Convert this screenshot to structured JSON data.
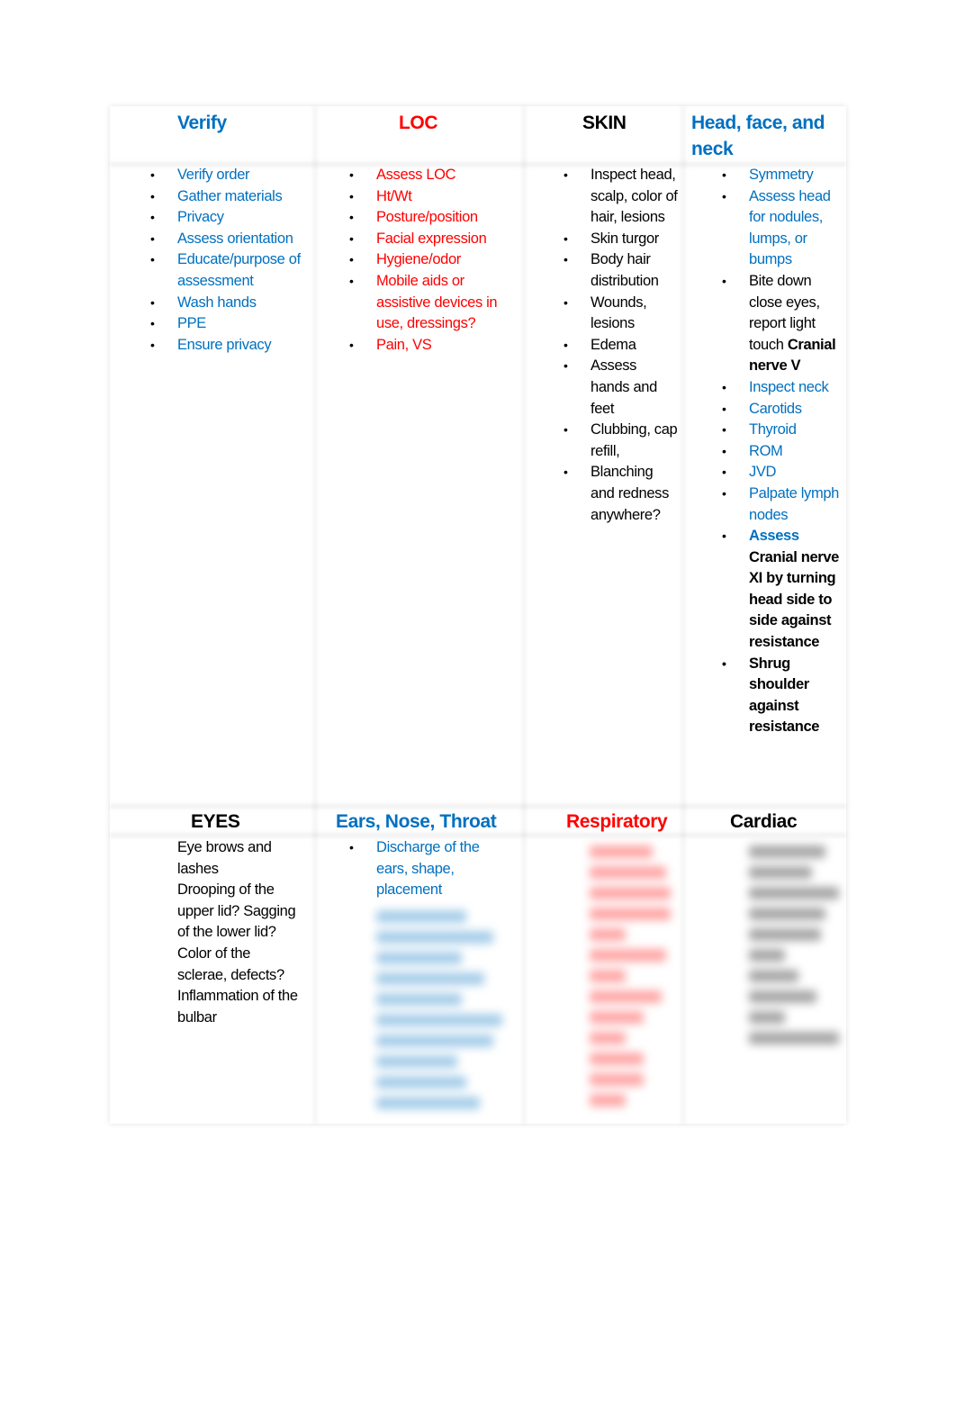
{
  "colors": {
    "blue": "#0070c0",
    "red": "#ff0000",
    "black": "#000000"
  },
  "row1": {
    "headers": [
      "Verify",
      "LOC",
      "SKIN",
      "Head, face, and neck"
    ],
    "verify": [
      "Verify order",
      "Gather materials",
      "Privacy",
      "Assess orientation",
      "Educate/purpose of assessment",
      "Wash hands",
      "PPE",
      "Ensure privacy"
    ],
    "loc": [
      "Assess LOC",
      "Ht/Wt",
      "Posture/position",
      "Facial expression",
      "Hygiene/odor",
      "Mobile aids or assistive devices in use, dressings?",
      "Pain, VS"
    ],
    "skin": [
      "Inspect head, scalp, color of hair, lesions",
      "Skin turgor",
      "Body hair distribution",
      "Wounds, lesions",
      "Edema",
      "Assess hands and feet",
      "Clubbing, cap refill,",
      "Blanching and redness anywhere?"
    ],
    "head": {
      "symmetry": "Symmetry",
      "nodules": "Assess head for nodules, lumps, or bumps",
      "bite": "Bite down close eyes, report  light touch",
      "cn5": "Cranial nerve V",
      "neck": "Inspect neck",
      "carotids": "Carotids",
      "thyroid": "Thyroid",
      "rom": "ROM",
      "jvd": "JVD",
      "lymph": "Palpate lymph nodes",
      "assess": "Assess",
      "cn11": "Cranial nerve XI by turning head side to side against resistance",
      "shrug": "Shrug shoulder against resistance"
    }
  },
  "row2": {
    "headers": [
      "EYES",
      "Ears, Nose, Throat",
      "Respiratory",
      "Cardiac"
    ],
    "eyes": [
      "Eye brows and lashes",
      "Drooping of the upper lid? Sagging of the lower lid?",
      "Color of the sclerae, defects?",
      "Inflammation of the bulbar"
    ],
    "ent": [
      "Discharge of the ears, shape, placement"
    ]
  }
}
